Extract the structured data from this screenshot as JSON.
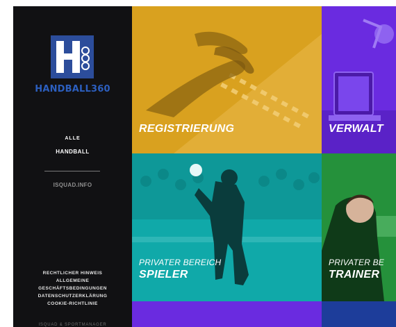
{
  "brand": {
    "name": "HANDBALL360",
    "logo_letter": "H",
    "logo_small": "360",
    "color": "#2c4d9b"
  },
  "nav": {
    "all": "ALLE",
    "handball": "HANDBALL",
    "isquad": "ISQUAD.INFO"
  },
  "legal": {
    "items": [
      "RECHTLICHER HINWEIS",
      "ALLGEMEINE",
      "GESCHÄFTSBEDINGUNGEN",
      "DATENSCHUTZERKLÄRUNG",
      "COOKIE-RICHTLINIE"
    ],
    "footer": "ISQUAD & SPORTMANAGER"
  },
  "tiles": [
    {
      "key": "registrierung",
      "title": "REGISTRIERUNG",
      "subtitle": "",
      "color": "#d9a11f"
    },
    {
      "key": "verwaltung",
      "title": "VERWALT",
      "subtitle": "",
      "color": "#6a2be0"
    },
    {
      "key": "spieler",
      "title": "SPIELER",
      "subtitle": "PRIVATER BEREICH",
      "color": "#10a9a9"
    },
    {
      "key": "trainer",
      "title": "TRAINER",
      "subtitle": "PRIVATER BE",
      "color": "#25913b"
    }
  ]
}
